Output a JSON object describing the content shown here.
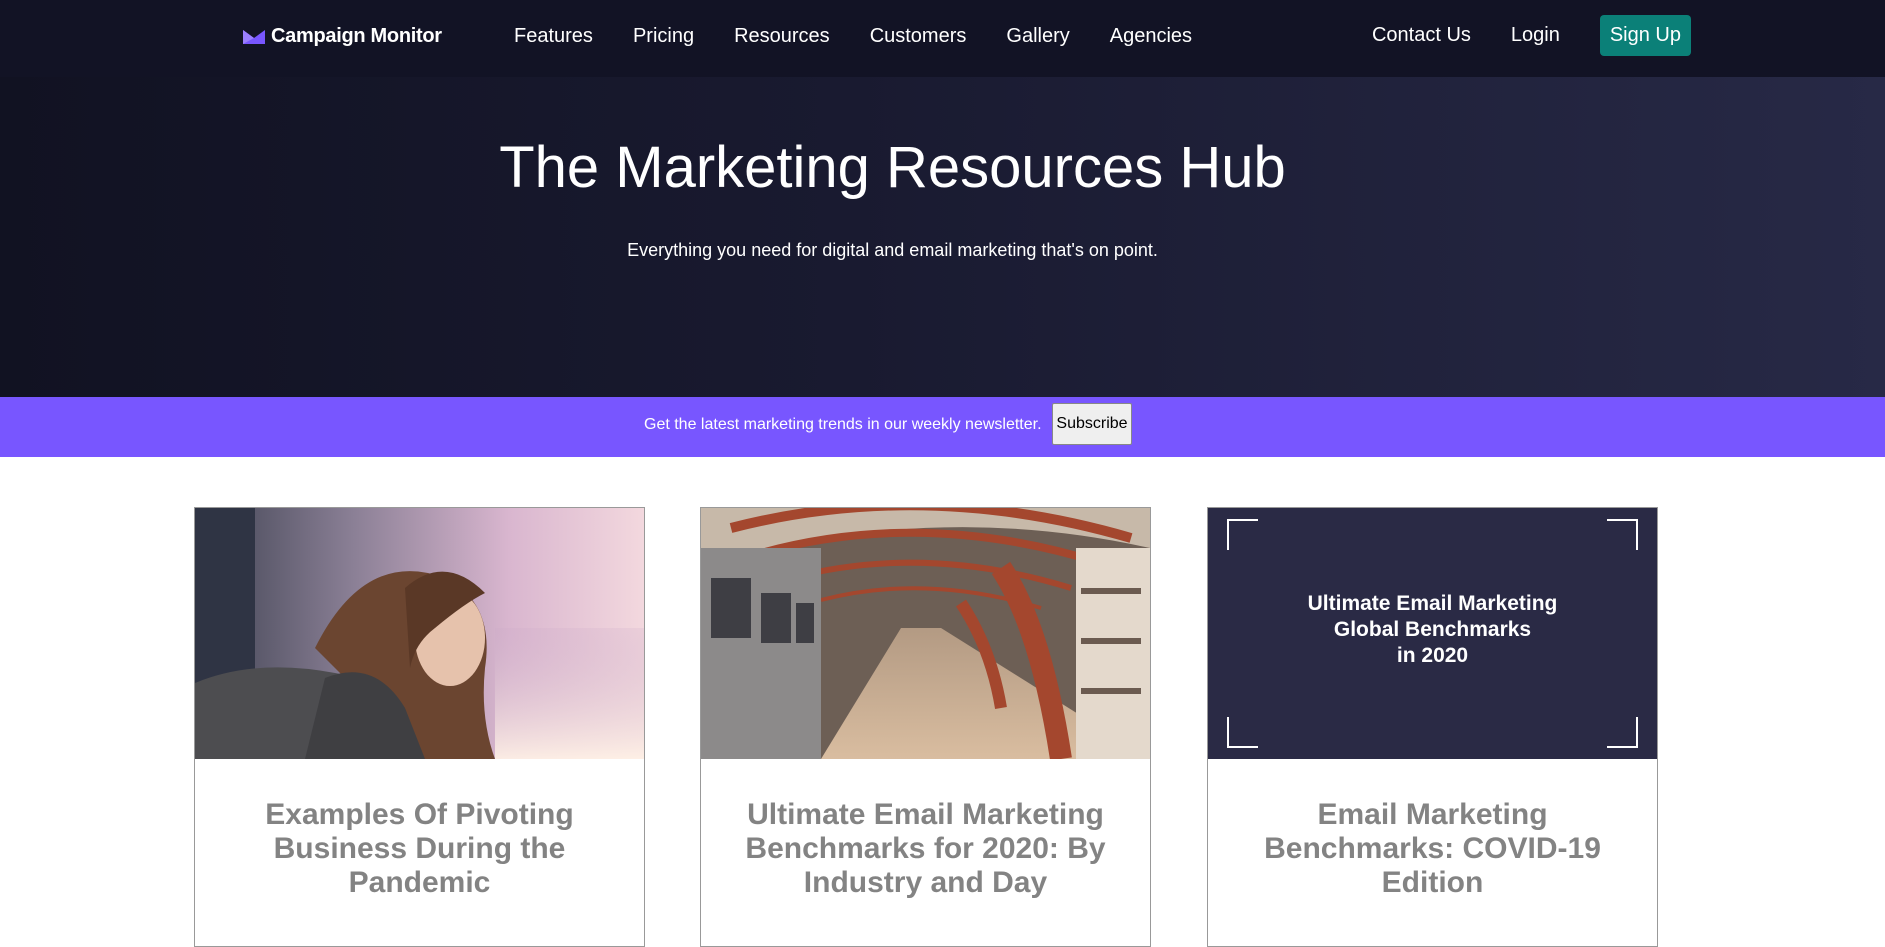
{
  "brand": {
    "name": "Campaign Monitor",
    "accent": "#7856ff"
  },
  "nav": {
    "links": [
      "Features",
      "Pricing",
      "Resources",
      "Customers",
      "Gallery",
      "Agencies"
    ],
    "right": {
      "contact": "Contact Us",
      "login": "Login",
      "signup": "Sign Up"
    }
  },
  "hero": {
    "title": "The Marketing Resources Hub",
    "subtitle": "Everything you need for digital and email marketing that's on point."
  },
  "newsletter": {
    "text": "Get the latest marketing trends in our weekly newsletter.",
    "button": "Subscribe"
  },
  "cards": [
    {
      "title": "Examples Of Pivoting Business During the Pandemic",
      "image": "woman-photo"
    },
    {
      "title": "Ultimate Email Marketing Benchmarks for 2020: By Industry and Day",
      "image": "subway-tunnel-photo"
    },
    {
      "title": "Email Marketing Benchmarks: COVID-19 Edition",
      "image": "benchmark-graphic",
      "image_text": [
        "Ultimate Email Marketing",
        "Global Benchmarks",
        "in 2020"
      ]
    }
  ],
  "colors": {
    "nav_bg": "#121325",
    "signup": "#0b8078",
    "newsletter_bg": "#7856ff",
    "card_title": "#838383"
  }
}
